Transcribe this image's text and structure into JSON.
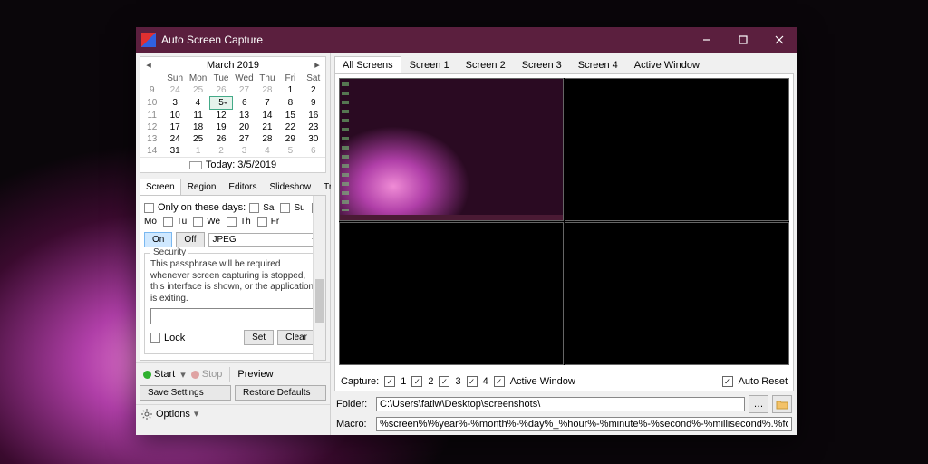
{
  "window": {
    "title": "Auto Screen Capture"
  },
  "calendar": {
    "title": "March 2019",
    "dow": [
      "Sun",
      "Mon",
      "Tue",
      "Wed",
      "Thu",
      "Fri",
      "Sat"
    ],
    "weeks": [
      {
        "wk": 9,
        "days": [
          {
            "d": 24,
            "dim": true
          },
          {
            "d": 25,
            "dim": true
          },
          {
            "d": 26,
            "dim": true
          },
          {
            "d": 27,
            "dim": true
          },
          {
            "d": 28,
            "dim": true
          },
          {
            "d": 1
          },
          {
            "d": 2
          }
        ]
      },
      {
        "wk": 10,
        "days": [
          {
            "d": 3
          },
          {
            "d": 4
          },
          {
            "d": 5,
            "sel": true
          },
          {
            "d": 6
          },
          {
            "d": 7
          },
          {
            "d": 8
          },
          {
            "d": 9
          }
        ]
      },
      {
        "wk": 11,
        "days": [
          {
            "d": 10
          },
          {
            "d": 11
          },
          {
            "d": 12
          },
          {
            "d": 13
          },
          {
            "d": 14
          },
          {
            "d": 15
          },
          {
            "d": 16
          }
        ]
      },
      {
        "wk": 12,
        "days": [
          {
            "d": 17
          },
          {
            "d": 18
          },
          {
            "d": 19
          },
          {
            "d": 20
          },
          {
            "d": 21
          },
          {
            "d": 22
          },
          {
            "d": 23
          }
        ]
      },
      {
        "wk": 13,
        "days": [
          {
            "d": 24
          },
          {
            "d": 25
          },
          {
            "d": 26
          },
          {
            "d": 27
          },
          {
            "d": 28
          },
          {
            "d": 29
          },
          {
            "d": 30
          }
        ]
      },
      {
        "wk": 14,
        "days": [
          {
            "d": 31
          },
          {
            "d": 1,
            "dim": true
          },
          {
            "d": 2,
            "dim": true
          },
          {
            "d": 3,
            "dim": true
          },
          {
            "d": 4,
            "dim": true
          },
          {
            "d": 5,
            "dim": true
          },
          {
            "d": 6,
            "dim": true
          }
        ]
      }
    ],
    "today_label": "Today: 3/5/2019"
  },
  "left_tabs": [
    "Screen",
    "Region",
    "Editors",
    "Slideshow",
    "Triggers"
  ],
  "left_tab_active": 0,
  "screen_tab": {
    "only_days_label": "Only on these days:",
    "days": [
      "Sa",
      "Su",
      "Mo",
      "Tu",
      "We",
      "Th",
      "Fr"
    ],
    "on_label": "On",
    "off_label": "Off",
    "format_selected": "JPEG",
    "security": {
      "legend": "Security",
      "desc": "This passphrase will be required whenever screen capturing is stopped, this interface is shown, or the application is exiting.",
      "lock_label": "Lock",
      "set_label": "Set",
      "clear_label": "Clear"
    }
  },
  "actions": {
    "start": "Start",
    "stop": "Stop",
    "preview": "Preview",
    "save_settings": "Save Settings",
    "restore_defaults": "Restore Defaults",
    "options": "Options"
  },
  "right_tabs": [
    "All Screens",
    "Screen 1",
    "Screen 2",
    "Screen 3",
    "Screen 4",
    "Active Window"
  ],
  "right_tab_active": 0,
  "capture": {
    "label": "Capture:",
    "items": [
      "1",
      "2",
      "3",
      "4"
    ],
    "active_window": "Active Window",
    "auto_reset": "Auto Reset"
  },
  "bottom": {
    "folder_label": "Folder:",
    "folder_value": "C:\\Users\\fatiw\\Desktop\\screenshots\\",
    "macro_label": "Macro:",
    "macro_value": "%screen%\\%year%-%month%-%day%_%hour%-%minute%-%second%-%millisecond%.%format%"
  }
}
